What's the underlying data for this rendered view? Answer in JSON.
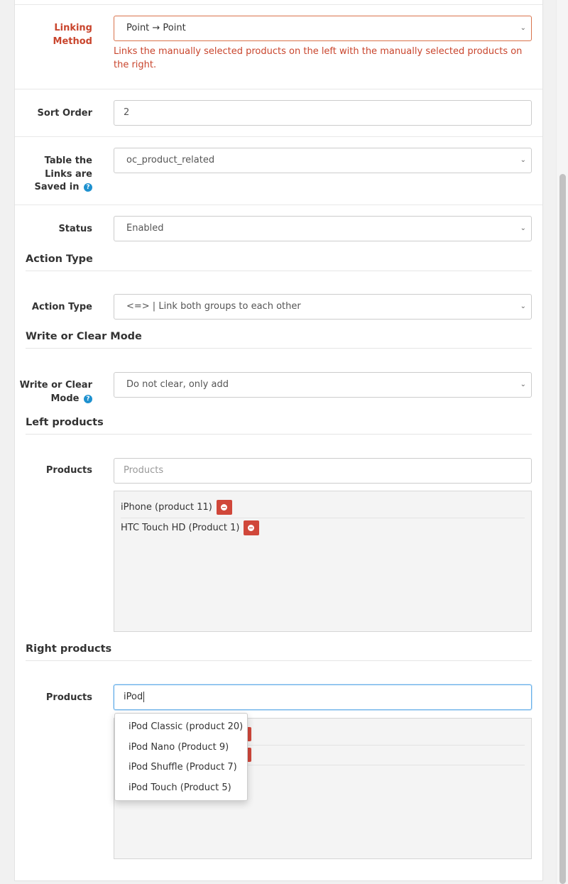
{
  "linking_method": {
    "label_line1": "Linking",
    "label_line2": "Method",
    "value": "Point → Point",
    "help": "Links the manually selected products on the left with the manually selected products on the right."
  },
  "sort_order": {
    "label": "Sort Order",
    "value": "2"
  },
  "table_saved": {
    "label_line1": "Table the",
    "label_line2": "Links are",
    "label_line3": "Saved in",
    "value": "oc_product_related"
  },
  "status": {
    "label": "Status",
    "value": "Enabled"
  },
  "action_type_section": {
    "title": "Action Type",
    "label": "Action Type",
    "value": "<=> | Link both groups to each other"
  },
  "write_clear_section": {
    "title": "Write or Clear Mode",
    "label_line1": "Write or Clear",
    "label_line2": "Mode",
    "value": "Do not clear, only add"
  },
  "left_products": {
    "title": "Left products",
    "label": "Products",
    "placeholder": "Products",
    "items": [
      {
        "name": "iPhone (product 11)"
      },
      {
        "name": "HTC Touch HD (Product 1)"
      }
    ]
  },
  "right_products": {
    "title": "Right products",
    "label": "Products",
    "value": "iPod",
    "suggestions": [
      "iPod Classic (product 20)",
      "iPod Nano (Product 9)",
      "iPod Shuffle (Product 7)",
      "iPod Touch (Product 5)"
    ]
  },
  "icons": {
    "help": "question-circle-icon",
    "remove": "minus-circle-icon",
    "select_arrow": "chevron-down-icon"
  },
  "colors": {
    "error": "#c9452d",
    "remove_button": "#d0473a",
    "help_icon": "#1e91cf",
    "focus_border": "#66afe9"
  }
}
